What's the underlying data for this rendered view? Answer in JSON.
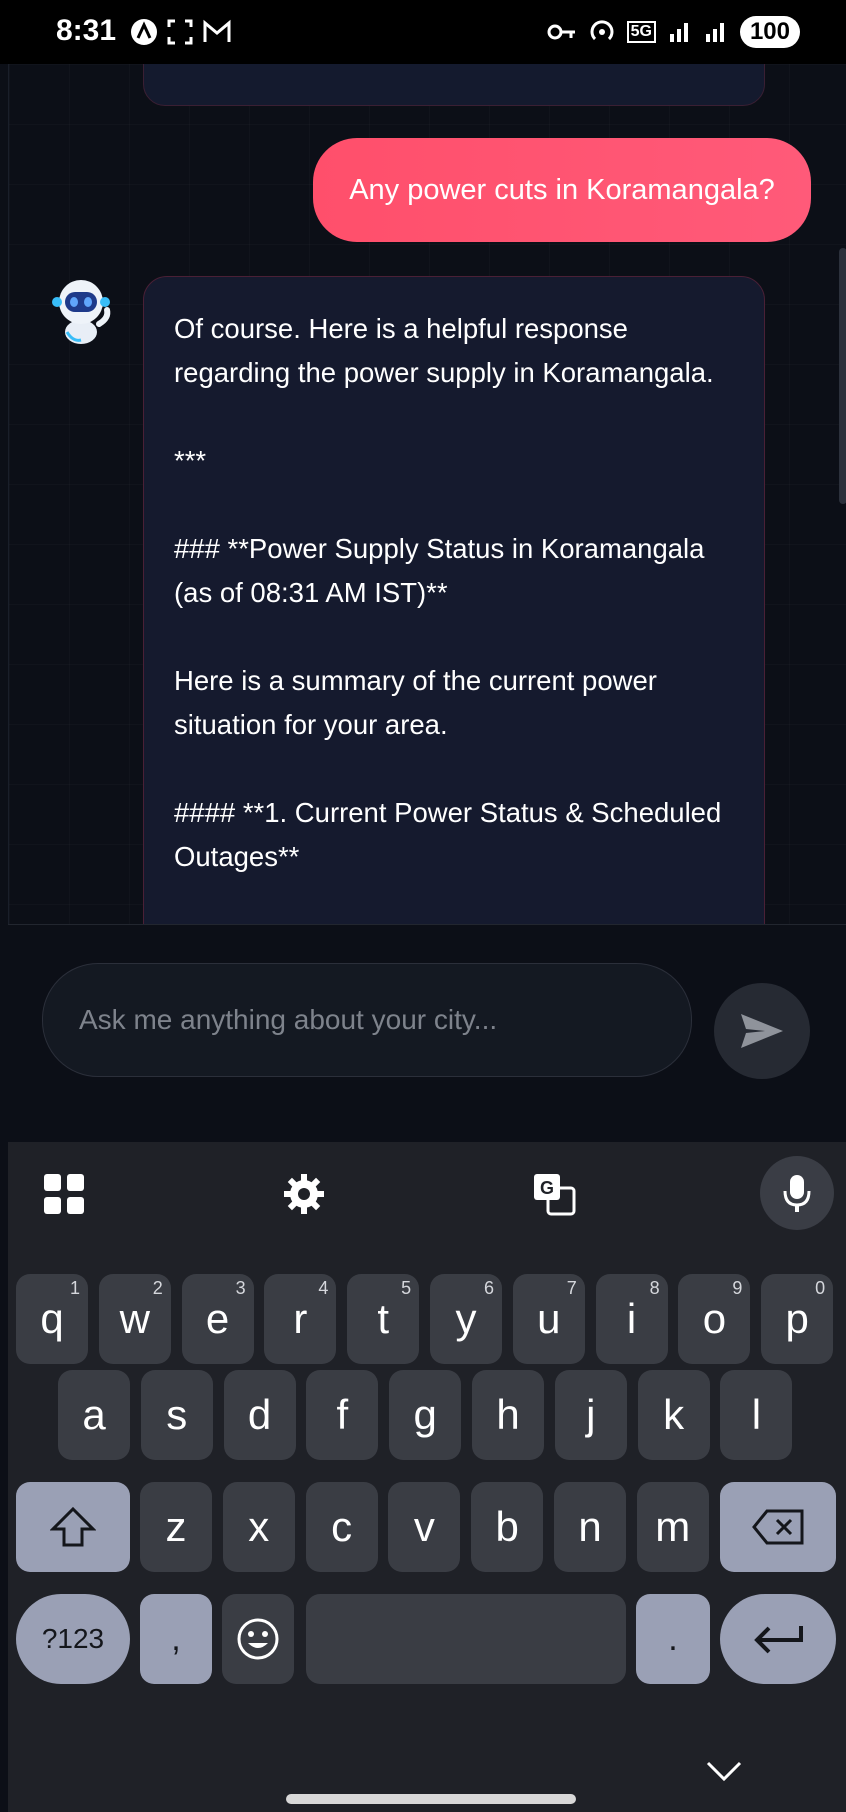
{
  "status_bar": {
    "time": "8:31",
    "network": "5G",
    "battery": "100"
  },
  "chat": {
    "user_message": "Any power cuts in Koramangala?",
    "bot_message": "Of course. Here is a helpful response regarding the power supply in Koramangala.\n\n***\n\n### **Power Supply Status in Koramangala (as of 08:31 AM IST)**\n\nHere is a summary of the current power situation for your area.\n\n#### **1. Current Power Status & Scheduled Outages**"
  },
  "input": {
    "placeholder": "Ask me anything about your city..."
  },
  "keyboard": {
    "row1": [
      {
        "k": "q",
        "h": "1"
      },
      {
        "k": "w",
        "h": "2"
      },
      {
        "k": "e",
        "h": "3"
      },
      {
        "k": "r",
        "h": "4"
      },
      {
        "k": "t",
        "h": "5"
      },
      {
        "k": "y",
        "h": "6"
      },
      {
        "k": "u",
        "h": "7"
      },
      {
        "k": "i",
        "h": "8"
      },
      {
        "k": "o",
        "h": "9"
      },
      {
        "k": "p",
        "h": "0"
      }
    ],
    "row2": [
      "a",
      "s",
      "d",
      "f",
      "g",
      "h",
      "j",
      "k",
      "l"
    ],
    "row3": [
      "z",
      "x",
      "c",
      "v",
      "b",
      "n",
      "m"
    ],
    "symbols_label": "?123",
    "comma_label": ",",
    "period_label": "."
  }
}
